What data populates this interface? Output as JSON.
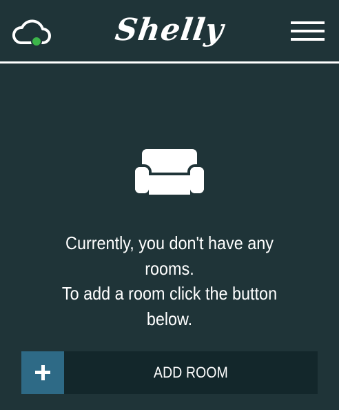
{
  "header": {
    "brand": "Shelly",
    "cloud_status": "connected",
    "cloud_icon": "cloud-icon",
    "menu_icon": "hamburger-menu-icon"
  },
  "empty_state": {
    "icon": "sofa-icon",
    "message_lines": [
      "Currently, you don't have any",
      "rooms.",
      "To add a room click the button",
      "below."
    ]
  },
  "add_room": {
    "icon": "plus-icon",
    "label": "ADD ROOM"
  },
  "colors": {
    "background": "#1f3438",
    "button_background": "#13272b",
    "accent": "#2e6a86",
    "status_online": "#3cb54a",
    "foreground": "#ffffff"
  }
}
